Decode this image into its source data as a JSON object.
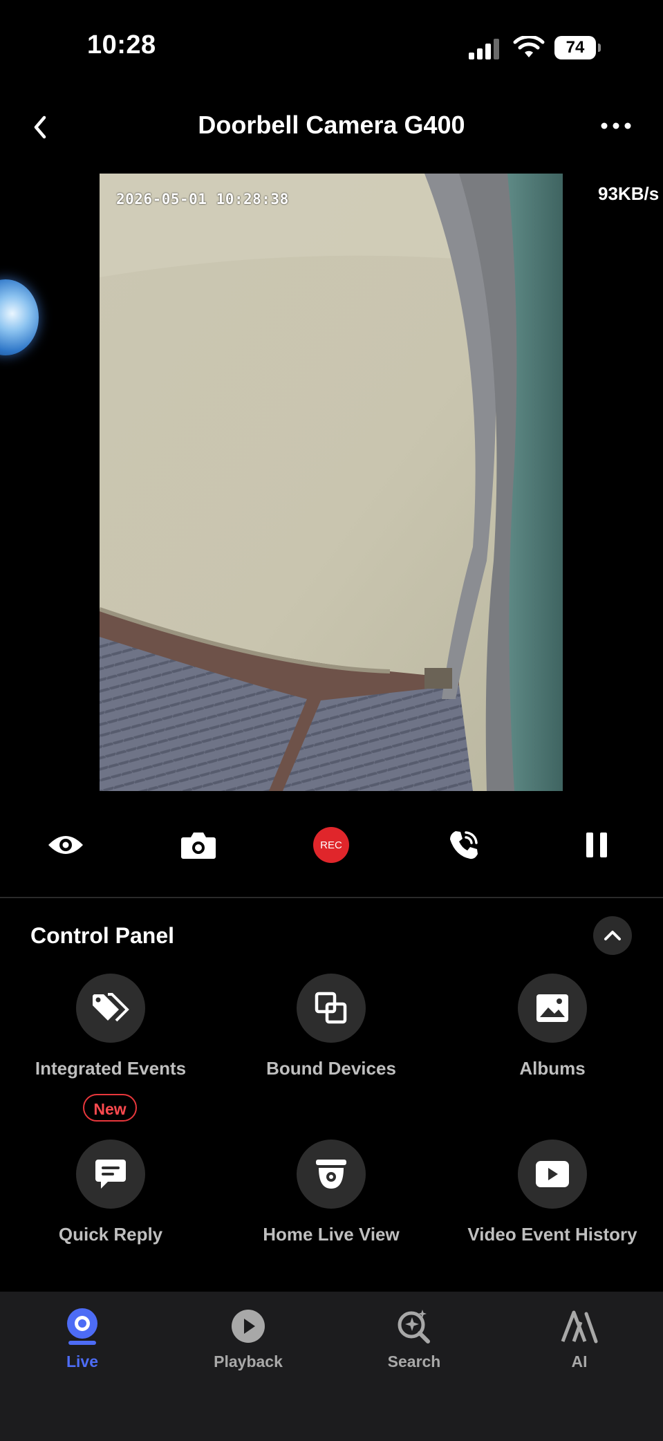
{
  "status_bar": {
    "time": "10:28",
    "battery": "74"
  },
  "header": {
    "title": "Doorbell Camera G400"
  },
  "video": {
    "timestamp": "2026-05-01  10:28:38",
    "bitrate": "93KB/s"
  },
  "controls": {
    "rec_label": "REC"
  },
  "control_panel": {
    "title": "Control Panel",
    "items": [
      {
        "label": "Integrated Events",
        "icon": "tag-icon",
        "badge": "New"
      },
      {
        "label": "Bound Devices",
        "icon": "bound-devices-icon"
      },
      {
        "label": "Albums",
        "icon": "image-icon"
      },
      {
        "label": "Quick Reply",
        "icon": "message-icon"
      },
      {
        "label": "Home Live View",
        "icon": "dome-camera-icon"
      },
      {
        "label": "Video Event History",
        "icon": "play-icon"
      }
    ]
  },
  "bottom_nav": {
    "active": "Live",
    "items": [
      {
        "label": "Live",
        "icon": "live-icon"
      },
      {
        "label": "Playback",
        "icon": "playback-icon"
      },
      {
        "label": "Search",
        "icon": "search-sparkle-icon"
      },
      {
        "label": "AI",
        "icon": "ai-icon"
      }
    ]
  },
  "colors": {
    "accent": "#4d6cf5",
    "rec": "#e0262b",
    "badge": "#ff4a4f",
    "nav_bg": "#1c1c1e"
  }
}
